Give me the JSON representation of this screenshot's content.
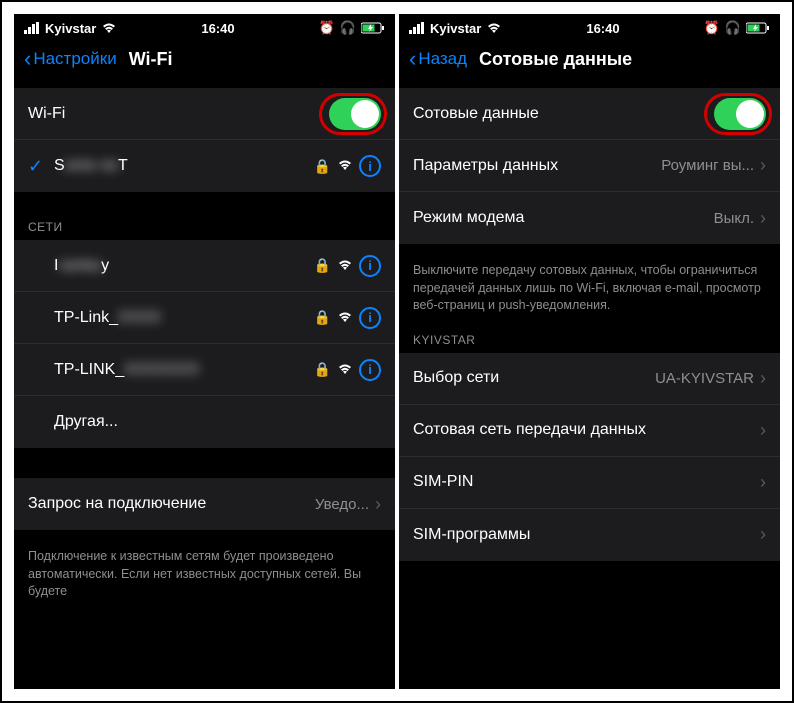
{
  "statusbar": {
    "carrier": "Kyivstar",
    "time": "16:40"
  },
  "left": {
    "back": "Настройки",
    "title": "Wi-Fi",
    "wifi_toggle_label": "Wi-Fi",
    "connected_prefix": "S",
    "connected_blur": "ome ne",
    "connected_suffix": "T",
    "section_networks": "СЕТИ",
    "networks": [
      {
        "prefix": "I",
        "blur": "vanka",
        "suffix": "y"
      },
      {
        "prefix": "TP-Link_",
        "blur": "XXXX",
        "suffix": ""
      },
      {
        "prefix": "TP-LINK_",
        "blur": "XXXXXXX",
        "suffix": ""
      }
    ],
    "other": "Другая...",
    "ask_to_join": "Запрос на подключение",
    "ask_to_join_value": "Уведо...",
    "footer": "Подключение к известным сетям будет произведено автоматически. Если нет известных доступных сетей. Вы будете"
  },
  "right": {
    "back": "Назад",
    "title": "Сотовые данные",
    "cellular_label": "Сотовые данные",
    "data_options": "Параметры данных",
    "data_options_value": "Роуминг вы...",
    "hotspot": "Режим модема",
    "hotspot_value": "Выкл.",
    "footer": "Выключите передачу сотовых данных, чтобы ограничиться передачей данных лишь по Wi-Fi, включая e-mail, просмотр веб-страниц и push-уведомления.",
    "section_carrier": "KYIVSTAR",
    "network_selection": "Выбор сети",
    "network_selection_value": "UA-KYIVSTAR",
    "cellular_data_network": "Сотовая сеть передачи данных",
    "sim_pin": "SIM-PIN",
    "sim_apps": "SIM-программы"
  }
}
